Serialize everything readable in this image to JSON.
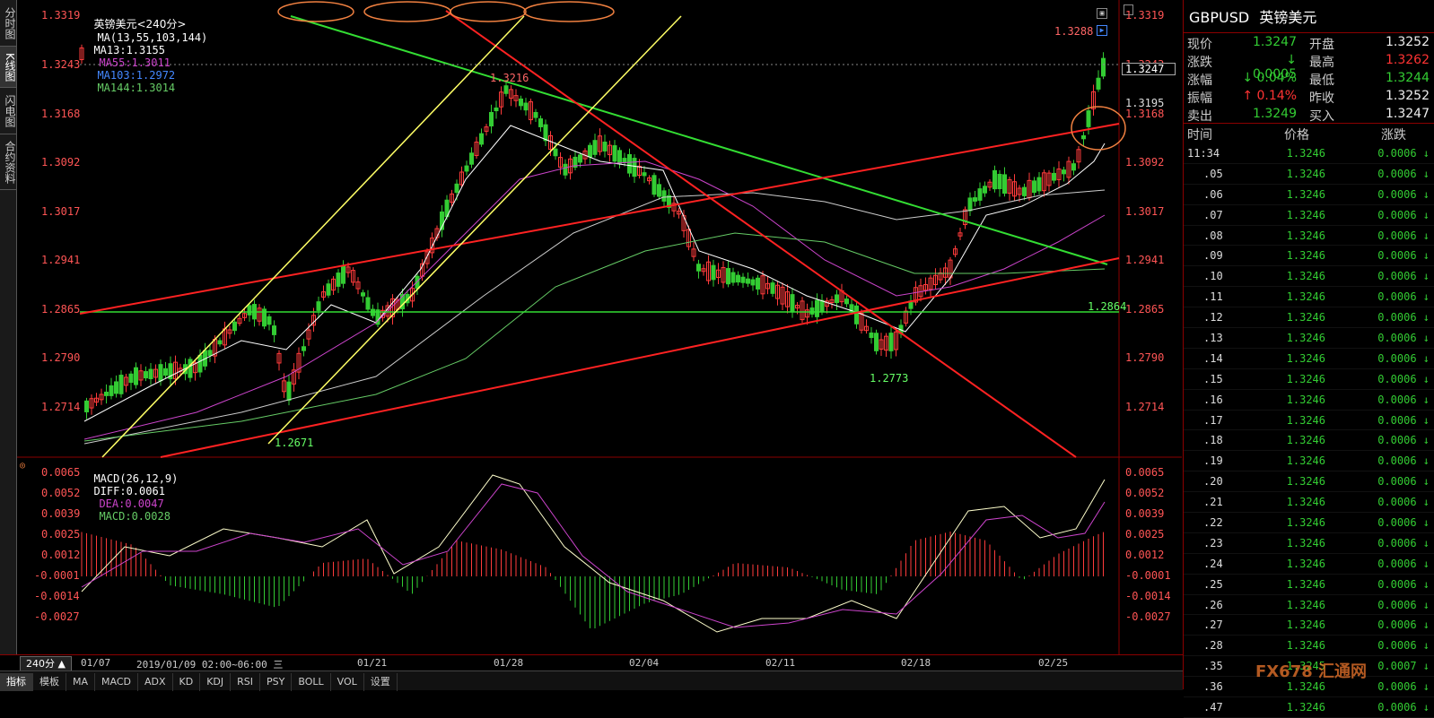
{
  "left_tabs": [
    "分时图",
    "K线图",
    "闪电图",
    "合约资料"
  ],
  "header": {
    "title": "英镑美元<240分>",
    "ma_def": "MA(13,55,103,144)",
    "ma13": "MA13:1.3155",
    "ma55": "MA55:1.3011",
    "ma103": "MA103:1.2972",
    "ma144": "MA144:1.3014"
  },
  "price_axis": [
    "1.3319",
    "1.3243",
    "1.3168",
    "1.3092",
    "1.3017",
    "1.2941",
    "1.2865",
    "1.2790",
    "1.2714"
  ],
  "right_price_labels": {
    "current": "1.3247",
    "level1": "1.3195",
    "level2": "1.3168",
    "support": "1.2864"
  },
  "annotations": {
    "high1": "1.3216",
    "high2": "1.3288",
    "low1": "1.2671",
    "low2": "1.2773"
  },
  "macd_header": {
    "def": "MACD(26,12,9)",
    "diff": "DIFF:0.0061",
    "dea": "DEA:0.0047",
    "macd": "MACD:0.0028"
  },
  "macd_axis": [
    "0.0065",
    "0.0052",
    "0.0039",
    "0.0025",
    "0.0012",
    "-0.0001",
    "-0.0014",
    "-0.0027"
  ],
  "date_bar": {
    "period": "240分 ▲",
    "dates": [
      "01/07",
      "01/21",
      "01/28",
      "02/04",
      "02/11",
      "02/18",
      "02/25"
    ],
    "cursor": "2019/01/09 02:00~06:00 三"
  },
  "bottom_tabs": [
    "指标",
    "模板",
    "MA",
    "MACD",
    "ADX",
    "KD",
    "KDJ",
    "RSI",
    "PSY",
    "BOLL",
    "VOL",
    "设置"
  ],
  "colors": {
    "up": "#ff3b3b",
    "down": "#33cc33",
    "ma13": "#ffffff",
    "ma55": "#cc44cc",
    "ma144": "#66cc66",
    "trend_red": "#ff2222",
    "trend_green": "#33dd33",
    "trend_yellow": "#ffff66"
  },
  "quote": {
    "symbol": "GBPUSD",
    "name": "英镑美元",
    "rows": [
      {
        "l1": "现价",
        "v1": "1.3247",
        "l2": "开盘",
        "v2": "1.3252"
      },
      {
        "l1": "涨跌",
        "v1": "↓ 0.0005",
        "l2": "最高",
        "v2": "1.3262"
      },
      {
        "l1": "涨幅",
        "v1": "↓ 0.04%",
        "l2": "最低",
        "v2": "1.3244"
      },
      {
        "l1": "振幅",
        "v1": "↑ 0.14%",
        "l2": "昨收",
        "v2": "1.3252"
      },
      {
        "l1": "卖出",
        "v1": "1.3249",
        "l2": "买入",
        "v2": "1.3247"
      }
    ]
  },
  "tick_header": {
    "time": "时间",
    "price": "价格",
    "change": "涨跌"
  },
  "ticks": [
    {
      "t": "11:34",
      "p": "1.3246",
      "c": "0.0006 ↓"
    },
    {
      "t": ".05",
      "p": "1.3246",
      "c": "0.0006 ↓"
    },
    {
      "t": ".06",
      "p": "1.3246",
      "c": "0.0006 ↓"
    },
    {
      "t": ".07",
      "p": "1.3246",
      "c": "0.0006 ↓"
    },
    {
      "t": ".08",
      "p": "1.3246",
      "c": "0.0006 ↓"
    },
    {
      "t": ".09",
      "p": "1.3246",
      "c": "0.0006 ↓"
    },
    {
      "t": ".10",
      "p": "1.3246",
      "c": "0.0006 ↓"
    },
    {
      "t": ".11",
      "p": "1.3246",
      "c": "0.0006 ↓"
    },
    {
      "t": ".12",
      "p": "1.3246",
      "c": "0.0006 ↓"
    },
    {
      "t": ".13",
      "p": "1.3246",
      "c": "0.0006 ↓"
    },
    {
      "t": ".14",
      "p": "1.3246",
      "c": "0.0006 ↓"
    },
    {
      "t": ".15",
      "p": "1.3246",
      "c": "0.0006 ↓"
    },
    {
      "t": ".16",
      "p": "1.3246",
      "c": "0.0006 ↓"
    },
    {
      "t": ".17",
      "p": "1.3246",
      "c": "0.0006 ↓"
    },
    {
      "t": ".18",
      "p": "1.3246",
      "c": "0.0006 ↓"
    },
    {
      "t": ".19",
      "p": "1.3246",
      "c": "0.0006 ↓"
    },
    {
      "t": ".20",
      "p": "1.3246",
      "c": "0.0006 ↓"
    },
    {
      "t": ".21",
      "p": "1.3246",
      "c": "0.0006 ↓"
    },
    {
      "t": ".22",
      "p": "1.3246",
      "c": "0.0006 ↓"
    },
    {
      "t": ".23",
      "p": "1.3246",
      "c": "0.0006 ↓"
    },
    {
      "t": ".24",
      "p": "1.3246",
      "c": "0.0006 ↓"
    },
    {
      "t": ".25",
      "p": "1.3246",
      "c": "0.0006 ↓"
    },
    {
      "t": ".26",
      "p": "1.3246",
      "c": "0.0006 ↓"
    },
    {
      "t": ".27",
      "p": "1.3246",
      "c": "0.0006 ↓"
    },
    {
      "t": ".28",
      "p": "1.3246",
      "c": "0.0006 ↓"
    },
    {
      "t": ".35",
      "p": "1.3245",
      "c": "0.0007 ↓"
    },
    {
      "t": ".36",
      "p": "1.3246",
      "c": "0.0006 ↓"
    },
    {
      "t": ".47",
      "p": "1.3246",
      "c": "0.0006 ↓"
    }
  ],
  "watermark": "FX678 汇通网"
}
